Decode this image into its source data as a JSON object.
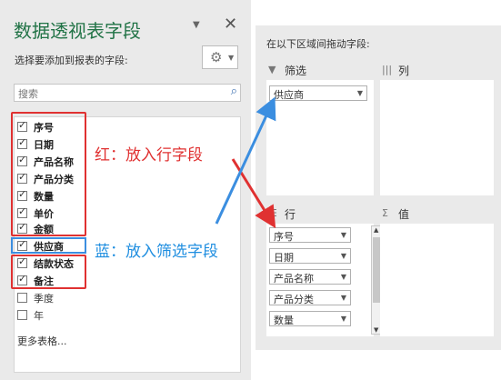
{
  "left_pane": {
    "title": "数据透视表字段",
    "choose_label": "选择要添加到报表的字段:",
    "search_placeholder": "搜索",
    "fields": [
      {
        "label": "序号",
        "checked": true
      },
      {
        "label": "日期",
        "checked": true
      },
      {
        "label": "产品名称",
        "checked": true
      },
      {
        "label": "产品分类",
        "checked": true
      },
      {
        "label": "数量",
        "checked": true
      },
      {
        "label": "单价",
        "checked": true
      },
      {
        "label": "金额",
        "checked": true
      },
      {
        "label": "供应商",
        "checked": true
      },
      {
        "label": "结款状态",
        "checked": true
      },
      {
        "label": "备注",
        "checked": true
      },
      {
        "label": "季度",
        "checked": false
      },
      {
        "label": "年",
        "checked": false
      }
    ],
    "more_tables": "更多表格..."
  },
  "right_pane": {
    "drag_label": "在以下区域间拖动字段:",
    "filter_area": {
      "title": "筛选",
      "items": [
        "供应商"
      ]
    },
    "column_area": {
      "title": "列"
    },
    "row_area": {
      "title": "行",
      "items": [
        "序号",
        "日期",
        "产品名称",
        "产品分类",
        "数量"
      ]
    },
    "value_area": {
      "title": "值"
    }
  },
  "annotations": {
    "red": "红：放入行字段",
    "blue": "蓝：放入筛选字段"
  },
  "colors": {
    "title_green": "#217346",
    "annotation_red": "#e03131",
    "annotation_blue": "#1f8ee0"
  }
}
